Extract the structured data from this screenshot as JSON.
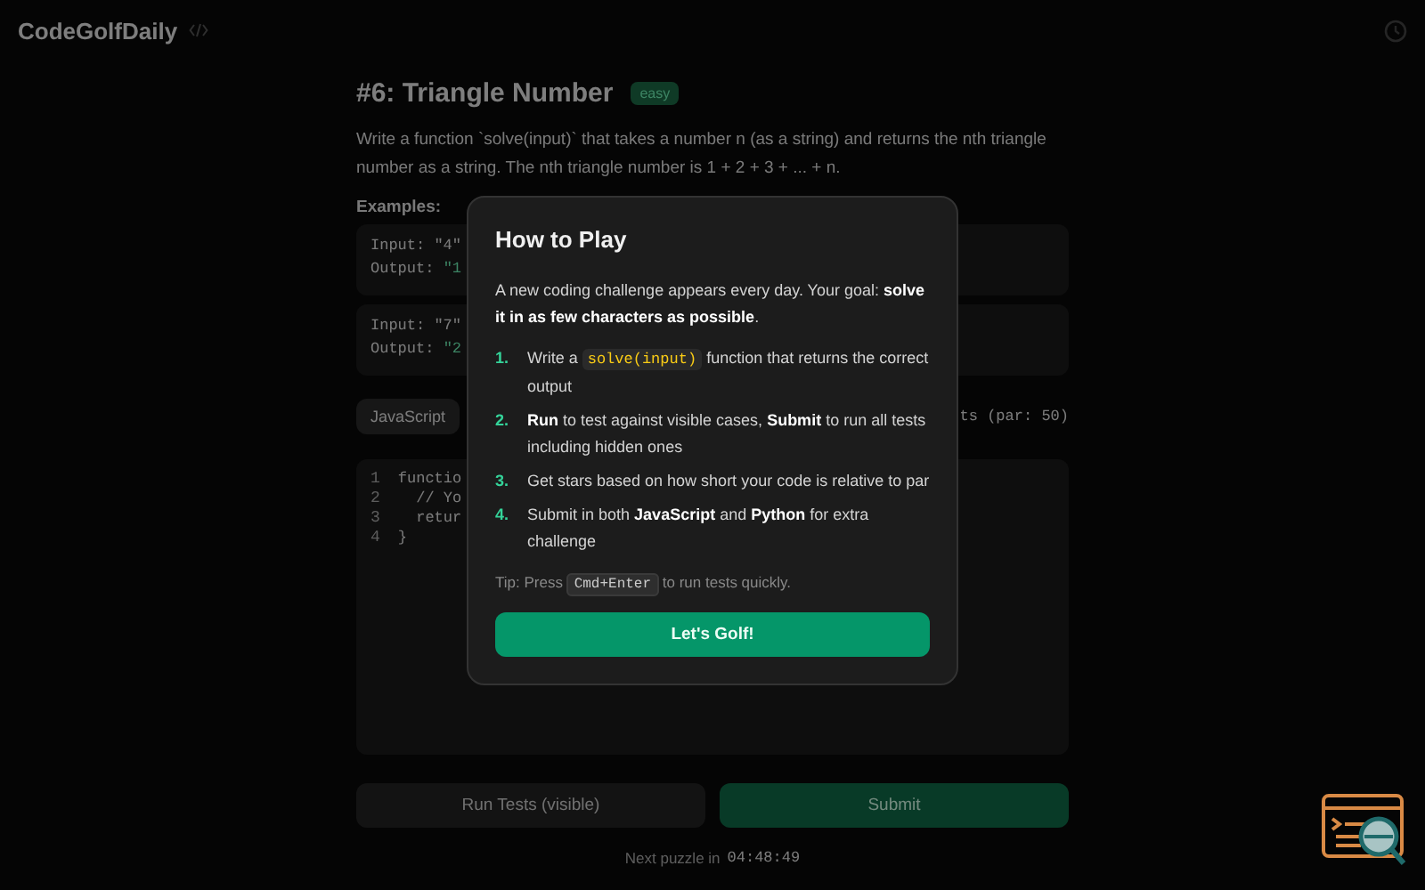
{
  "header": {
    "logo": "CodeGolfDaily"
  },
  "challenge": {
    "title": "#6: Triangle Number",
    "difficulty": "easy",
    "description": "Write a function `solve(input)` that takes a number n (as a string) and returns the nth triangle number as a string. The nth triangle number is 1 + 2 + 3 + ... + n.",
    "examples_label": "Examples:",
    "examples": [
      {
        "input": "Input: \"4\"",
        "output_label": "Output:",
        "output_value": "\"1"
      },
      {
        "input": "Input: \"7\"",
        "output_label": "Output:",
        "output_value": "\"2"
      }
    ]
  },
  "editor": {
    "languages": [
      {
        "label": "JavaScript",
        "selected": true
      }
    ],
    "par_text": "ts (par: 50)",
    "lines": [
      {
        "number": "1",
        "code": "functio"
      },
      {
        "number": "2",
        "code": "  // Yo"
      },
      {
        "number": "3",
        "code": "  retur"
      },
      {
        "number": "4",
        "code": "}"
      }
    ]
  },
  "actions": {
    "run": "Run Tests (visible)",
    "submit": "Submit"
  },
  "footer": {
    "label": "Next puzzle in",
    "time": "04:48:49"
  },
  "modal": {
    "title": "How to Play",
    "intro": "A new coding challenge appears every day. Your goal: **solve it in as few characters as possible**.",
    "steps": [
      {
        "number": "1.",
        "parts": [
          {
            "kind": "text",
            "text": "Write a "
          },
          {
            "kind": "code",
            "text": "solve(input)"
          },
          {
            "kind": "text",
            "text": " function that returns the correct output"
          }
        ]
      },
      {
        "number": "2.",
        "parts": [
          {
            "kind": "text",
            "text": "**Run** to test against visible cases, **Submit** to run all tests including hidden ones"
          }
        ]
      },
      {
        "number": "3.",
        "parts": [
          {
            "kind": "text",
            "text": "Get stars based on how short your code is relative to par"
          }
        ]
      },
      {
        "number": "4.",
        "parts": [
          {
            "kind": "text",
            "text": "Submit in both **JavaScript** and **Python** for extra challenge"
          }
        ]
      }
    ],
    "tip": [
      {
        "kind": "text",
        "text": "Tip: Press "
      },
      {
        "kind": "code",
        "text": "Cmd+Enter"
      },
      {
        "kind": "text",
        "text": " to run tests quickly."
      }
    ],
    "button": "Let's Golf!"
  }
}
